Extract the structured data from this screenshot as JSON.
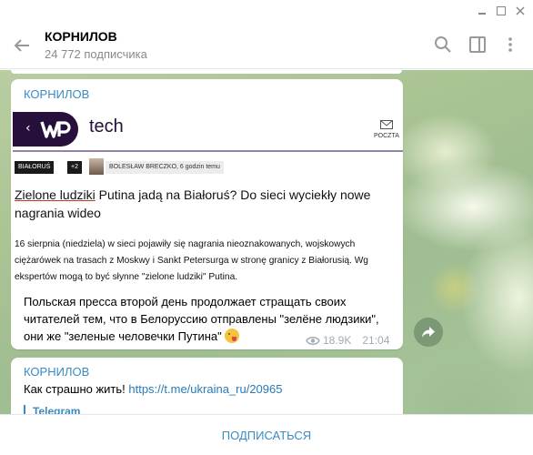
{
  "window": {
    "min_icon": "minimize-icon",
    "max_icon": "maximize-icon",
    "close_icon": "close-icon"
  },
  "header": {
    "title": "КОРНИЛОВ",
    "subscribers": "24 772 подписчика",
    "icons": [
      "back-arrow-icon",
      "search-icon",
      "sidebar-panel-icon",
      "more-vertical-icon"
    ]
  },
  "messages": [
    {
      "sender": "КОРНИЛОВ",
      "embed": {
        "logo_text": "tech",
        "mail_label": "POCZTA",
        "tags": [
          "BIAŁORUŚ",
          "+2"
        ],
        "author": "BOLESŁAW BRECZKO, 6 godzin temu",
        "headline_link": "Zielone ludziki",
        "headline_rest": " Putina jadą na Białoruś? Do sieci wyciekły nowe nagrania wideo",
        "lead": "16 sierpnia (niedziela) w sieci pojawiły się nagrania nieoznakowanych, wojskowych ciężarówek na trasach z Moskwy i Sankt Petersurga w stronę granicy z Białorusią. Wg ekspertów mogą to być słynne \"zielone ludziki\" Putina."
      },
      "text": "Польская пресса второй день продолжает стращать своих читателей тем, что в Белоруссию отправлены \"зелёне людзики\", они же \"зеленые человечки Путина\"",
      "emoji": "zany-face-emoji",
      "views": "18.9K",
      "time": "21:04"
    },
    {
      "sender": "КОРНИЛОВ",
      "text": "Как страшно жить! ",
      "link": "https://t.me/ukraina_ru/20965",
      "preview_title": "Telegram"
    }
  ],
  "share_icon": "share-forward-icon",
  "footer": {
    "subscribe_label": "ПОДПИСАТЬСЯ"
  },
  "colors": {
    "accent": "#3a8bc4",
    "wp_brand": "#260f3a"
  }
}
